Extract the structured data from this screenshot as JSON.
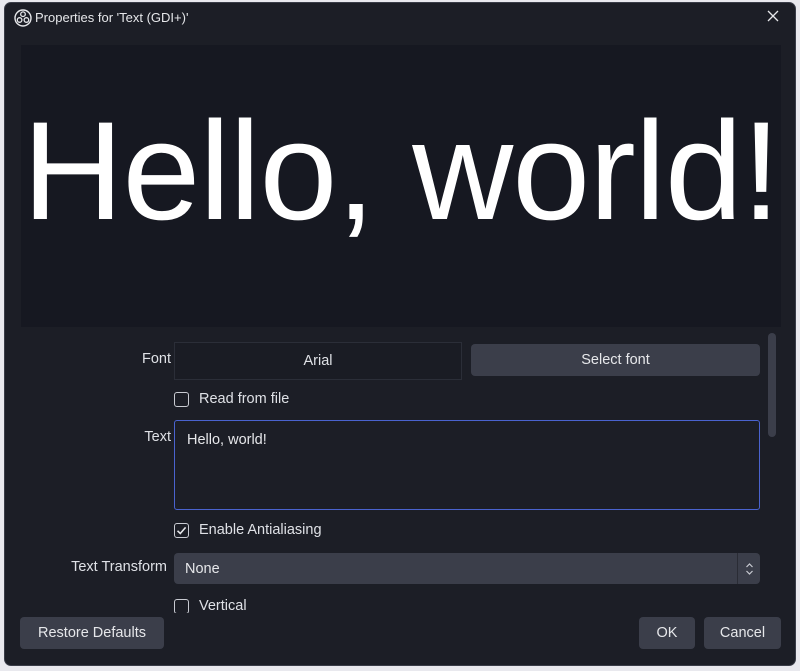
{
  "window": {
    "title": "Properties for 'Text (GDI+)'",
    "app_icon": "obs-logo-icon",
    "close_icon": "close-icon"
  },
  "preview": {
    "text": "Hello, world!"
  },
  "properties": {
    "font": {
      "label": "Font",
      "value": "Arial",
      "select_button": "Select font"
    },
    "read_from_file": {
      "label": "Read from file",
      "checked": false
    },
    "text": {
      "label": "Text",
      "value": "Hello, world!"
    },
    "antialiasing": {
      "label": "Enable Antialiasing",
      "checked": true
    },
    "text_transform": {
      "label": "Text Transform",
      "value": "None"
    },
    "vertical": {
      "label": "Vertical",
      "checked": false
    }
  },
  "footer": {
    "restore_defaults": "Restore Defaults",
    "ok": "OK",
    "cancel": "Cancel"
  },
  "colors": {
    "window_bg": "#1c1e26",
    "preview_bg": "#161821",
    "button_bg": "#3b3e4a",
    "focus_border": "#4a63cf"
  }
}
